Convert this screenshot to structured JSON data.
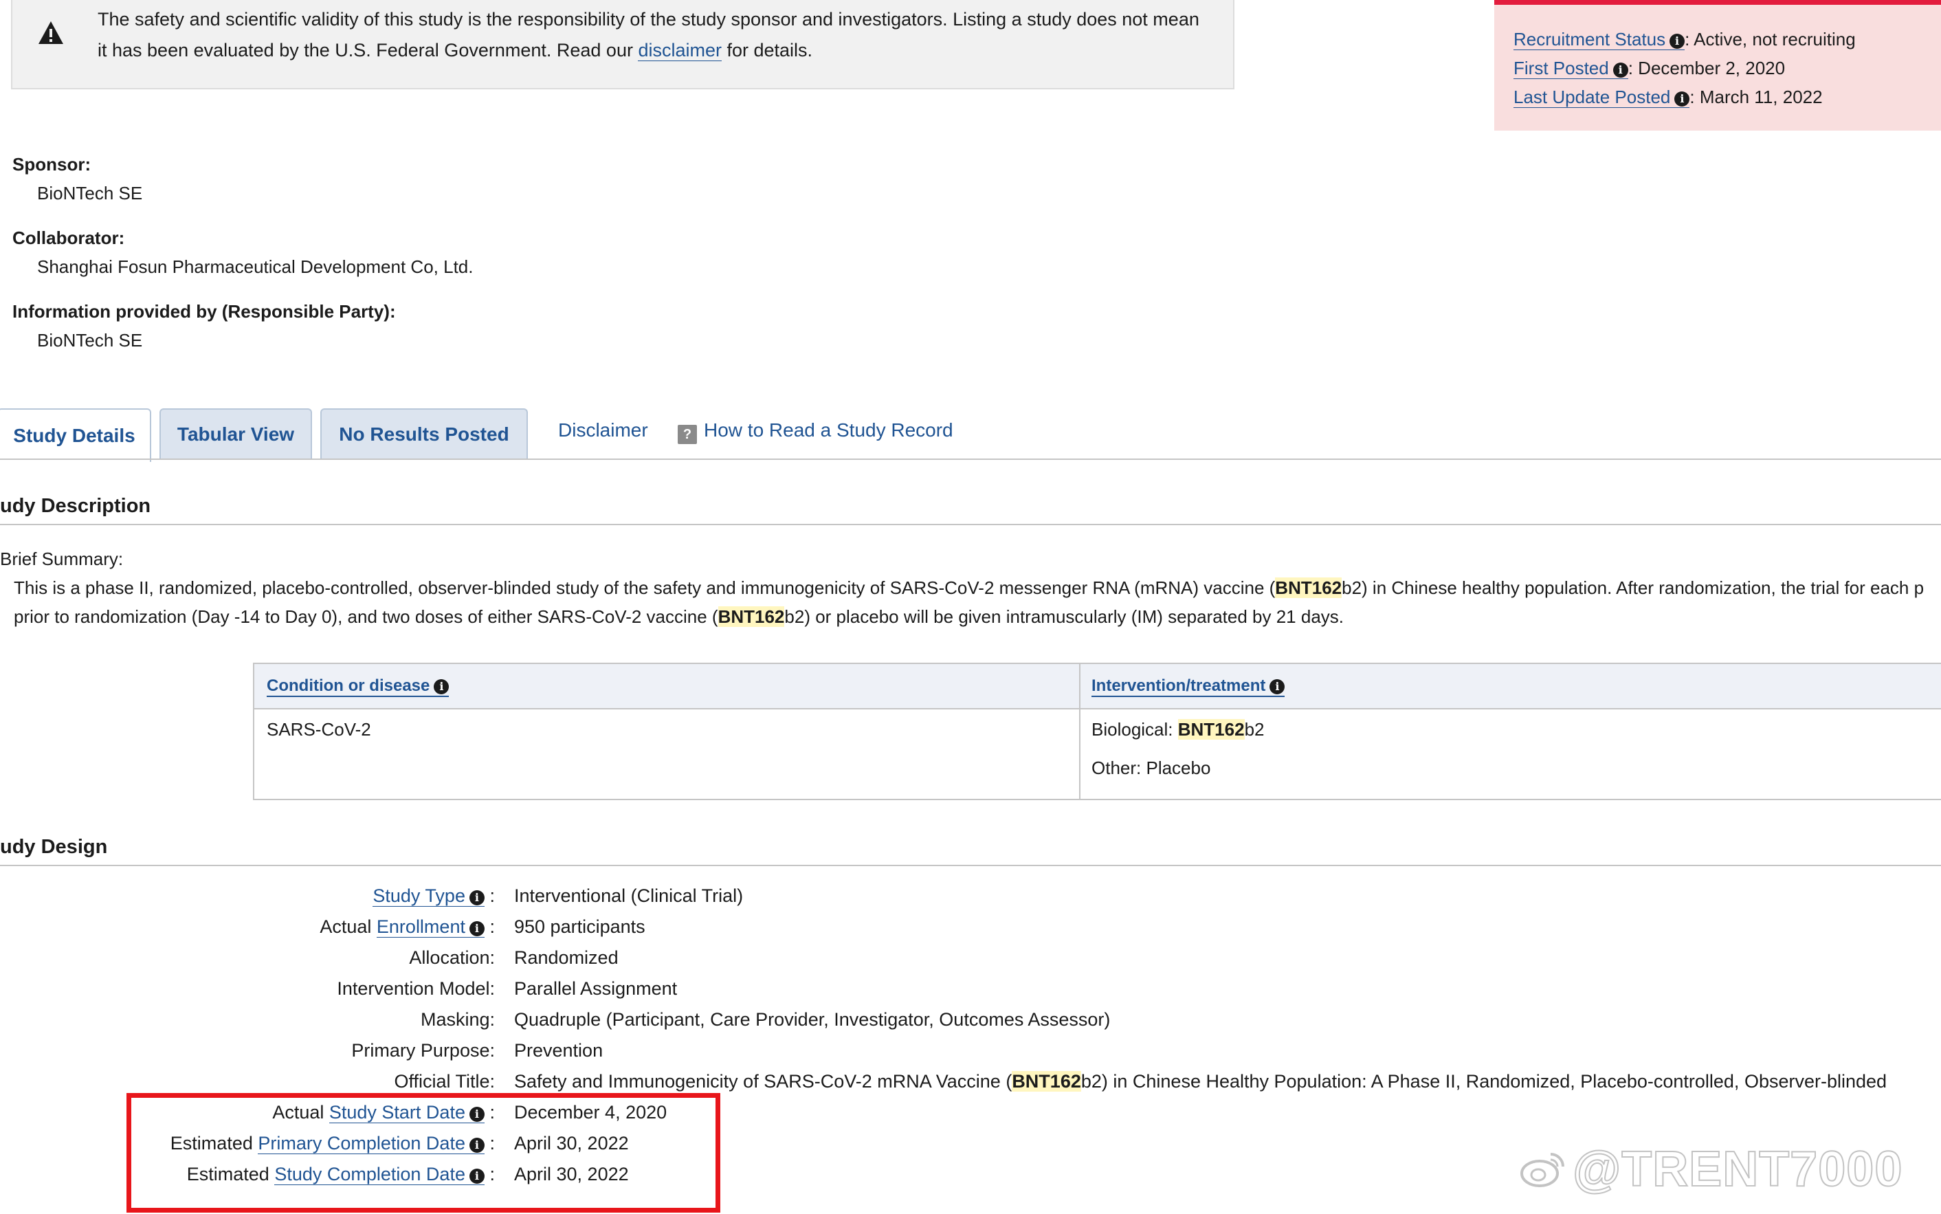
{
  "notice": {
    "text_before": "The safety and scientific validity of this study is the responsibility of the study sponsor and investigators. Listing a study does not mean it has been evaluated by the U.S. Federal Government. Read our ",
    "link": "disclaimer",
    "text_after": " for details."
  },
  "status": {
    "recruitment_label": "Recruitment Status",
    "recruitment_value": ": Active, not recruiting",
    "first_posted_label": "First Posted",
    "first_posted_value": ": December 2, 2020",
    "last_update_label": "Last Update Posted",
    "last_update_value": ": March 11, 2022"
  },
  "sponsor": {
    "label": "Sponsor:",
    "value": "BioNTech SE"
  },
  "collaborator": {
    "label": "Collaborator:",
    "value": "Shanghai Fosun Pharmaceutical Development Co, Ltd."
  },
  "responsible": {
    "label": "Information provided by (Responsible Party):",
    "value": "BioNTech SE"
  },
  "tabs": {
    "study_details": "Study Details",
    "tabular_view": "Tabular View",
    "no_results": "No Results Posted",
    "disclaimer": "Disclaimer",
    "how_to_read": "How to Read a Study Record"
  },
  "description": {
    "heading": "udy Description",
    "brief_label": "Brief Summary:",
    "line1_a": "This is a phase II, randomized, placebo-controlled, observer-blinded study of the safety and immunogenicity of SARS-CoV-2 messenger RNA (mRNA) vaccine (",
    "line1_mark": "BNT162",
    "line1_b": "b2) in Chinese healthy population. After randomization, the trial for each p",
    "line2_a": "prior to randomization (Day -14 to Day 0), and two doses of either SARS-CoV-2 vaccine (",
    "line2_mark": "BNT162",
    "line2_b": "b2) or placebo will be given intramuscularly (IM) separated by 21 days."
  },
  "condition_table": {
    "col1_header": "Condition or disease",
    "col2_header": "Intervention/treatment",
    "condition": "SARS-CoV-2",
    "intervention1_prefix": "Biological: ",
    "intervention1_mark": "BNT162",
    "intervention1_suffix": "b2",
    "intervention2": "Other: Placebo"
  },
  "design": {
    "heading": "udy Design",
    "study_type_label": "Study Type",
    "study_type_value": "Interventional  (Clinical Trial)",
    "enrollment_prefix": "Actual ",
    "enrollment_label": "Enrollment",
    "enrollment_value": "950 participants",
    "allocation_label": "Allocation:",
    "allocation_value": "Randomized",
    "model_label": "Intervention Model:",
    "model_value": "Parallel Assignment",
    "masking_label": "Masking:",
    "masking_value": "Quadruple (Participant, Care Provider, Investigator, Outcomes Assessor)",
    "purpose_label": "Primary Purpose:",
    "purpose_value": "Prevention",
    "official_label": "Official Title:",
    "official_a": "Safety and Immunogenicity of SARS-CoV-2 mRNA Vaccine (",
    "official_mark": "BNT162",
    "official_b": "b2) in Chinese Healthy Population: A Phase II, Randomized, Placebo-controlled, Observer-blinded",
    "start_prefix": "Actual ",
    "start_label": "Study Start Date",
    "start_value": "December 4, 2020",
    "primary_prefix": "Estimated ",
    "primary_label": "Primary Completion Date",
    "primary_value": "April 30, 2022",
    "completion_prefix": "Estimated ",
    "completion_label": "Study Completion Date",
    "completion_value": "April 30, 2022",
    "colon": ":"
  },
  "info_glyph": "i",
  "help_glyph": "?",
  "watermark": "@TRENT7000",
  "colors": {
    "link": "#205493",
    "status_bg": "#f9dede",
    "status_border": "#e31c3d",
    "highlight_box": "#e8161b",
    "mark_bg": "#fff6bf"
  }
}
